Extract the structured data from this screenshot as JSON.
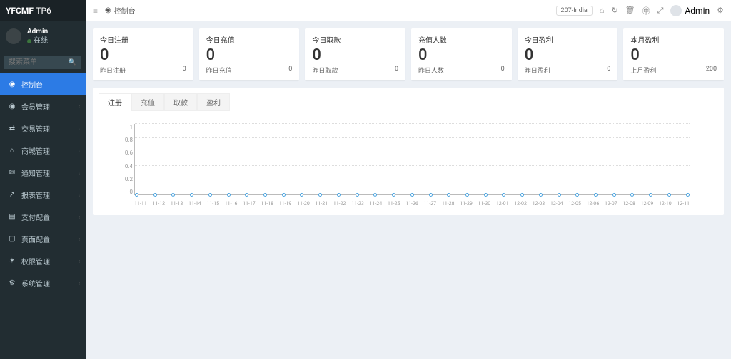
{
  "brand": {
    "bold": "YFCMF",
    "light": "-TP6"
  },
  "user": {
    "name": "Admin",
    "status": "在线"
  },
  "search": {
    "placeholder": "搜索菜单"
  },
  "nav": [
    {
      "icon": "◉",
      "label": "控制台",
      "active": true,
      "chev": false
    },
    {
      "icon": "◉",
      "label": "会员管理",
      "active": false,
      "chev": true
    },
    {
      "icon": "⇄",
      "label": "交易管理",
      "active": false,
      "chev": true
    },
    {
      "icon": "⌂",
      "label": "商城管理",
      "active": false,
      "chev": true
    },
    {
      "icon": "✉",
      "label": "通知管理",
      "active": false,
      "chev": true
    },
    {
      "icon": "↗",
      "label": "报表管理",
      "active": false,
      "chev": true
    },
    {
      "icon": "▤",
      "label": "支付配置",
      "active": false,
      "chev": true
    },
    {
      "icon": "▢",
      "label": "页面配置",
      "active": false,
      "chev": true
    },
    {
      "icon": "✶",
      "label": "权限管理",
      "active": false,
      "chev": true
    },
    {
      "icon": "⚙",
      "label": "系统管理",
      "active": false,
      "chev": true
    }
  ],
  "breadcrumb": {
    "label": "控制台"
  },
  "topbar": {
    "badge": "207-India",
    "user": "Admin"
  },
  "stats": [
    {
      "title": "今日注册",
      "big": "0",
      "sub": "昨日注册",
      "val": "0"
    },
    {
      "title": "今日充值",
      "big": "0",
      "sub": "昨日充值",
      "val": "0"
    },
    {
      "title": "今日取款",
      "big": "0",
      "sub": "昨日取款",
      "val": "0"
    },
    {
      "title": "充值人数",
      "big": "0",
      "sub": "昨日人数",
      "val": "0"
    },
    {
      "title": "今日盈利",
      "big": "0",
      "sub": "昨日盈利",
      "val": "0"
    },
    {
      "title": "本月盈利",
      "big": "0",
      "sub": "上月盈利",
      "val": "200"
    }
  ],
  "tabs": [
    "注册",
    "充值",
    "取款",
    "盈利"
  ],
  "chart_data": {
    "type": "line",
    "categories": [
      "11-11",
      "11-12",
      "11-13",
      "11-14",
      "11-15",
      "11-16",
      "11-17",
      "11-18",
      "11-19",
      "11-20",
      "11-21",
      "11-22",
      "11-23",
      "11-24",
      "11-25",
      "11-26",
      "11-27",
      "11-28",
      "11-29",
      "11-30",
      "12-01",
      "12-02",
      "12-03",
      "12-04",
      "12-05",
      "12-06",
      "12-07",
      "12-08",
      "12-09",
      "12-10",
      "12-11"
    ],
    "values": [
      0,
      0,
      0,
      0,
      0,
      0,
      0,
      0,
      0,
      0,
      0,
      0,
      0,
      0,
      0,
      0,
      0,
      0,
      0,
      0,
      0,
      0,
      0,
      0,
      0,
      0,
      0,
      0,
      0,
      0,
      0
    ],
    "yticks": [
      0,
      0.2,
      0.4,
      0.6,
      0.8,
      1
    ],
    "ylim": [
      0,
      1
    ]
  }
}
